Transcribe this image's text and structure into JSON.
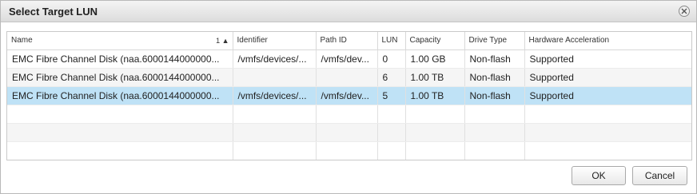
{
  "dialog": {
    "title": "Select Target LUN",
    "ok_label": "OK",
    "cancel_label": "Cancel"
  },
  "table": {
    "columns": [
      "Name",
      "Identifier",
      "Path ID",
      "LUN",
      "Capacity",
      "Drive Type",
      "Hardware Acceleration"
    ],
    "sort_indicator": "1 ▲",
    "rows": [
      {
        "name": "EMC Fibre Channel Disk (naa.6000144000000...",
        "identifier": "/vmfs/devices/...",
        "path_id": "/vmfs/dev...",
        "lun": "0",
        "capacity": "1.00 GB",
        "drive_type": "Non-flash",
        "hw_accel": "Supported"
      },
      {
        "name": "EMC Fibre Channel Disk (naa.6000144000000...",
        "identifier": "",
        "path_id": "",
        "lun": "6",
        "capacity": "1.00 TB",
        "drive_type": "Non-flash",
        "hw_accel": "Supported"
      },
      {
        "name": "EMC Fibre Channel Disk (naa.6000144000000...",
        "identifier": "/vmfs/devices/...",
        "path_id": "/vmfs/dev...",
        "lun": "5",
        "capacity": "1.00 TB",
        "drive_type": "Non-flash",
        "hw_accel": "Supported"
      }
    ],
    "selected_row_index": 2
  },
  "icons": {
    "close": "close-icon"
  },
  "colors": {
    "selected_row": "#bfe2f6",
    "title_bar": "#dcdcdc"
  }
}
